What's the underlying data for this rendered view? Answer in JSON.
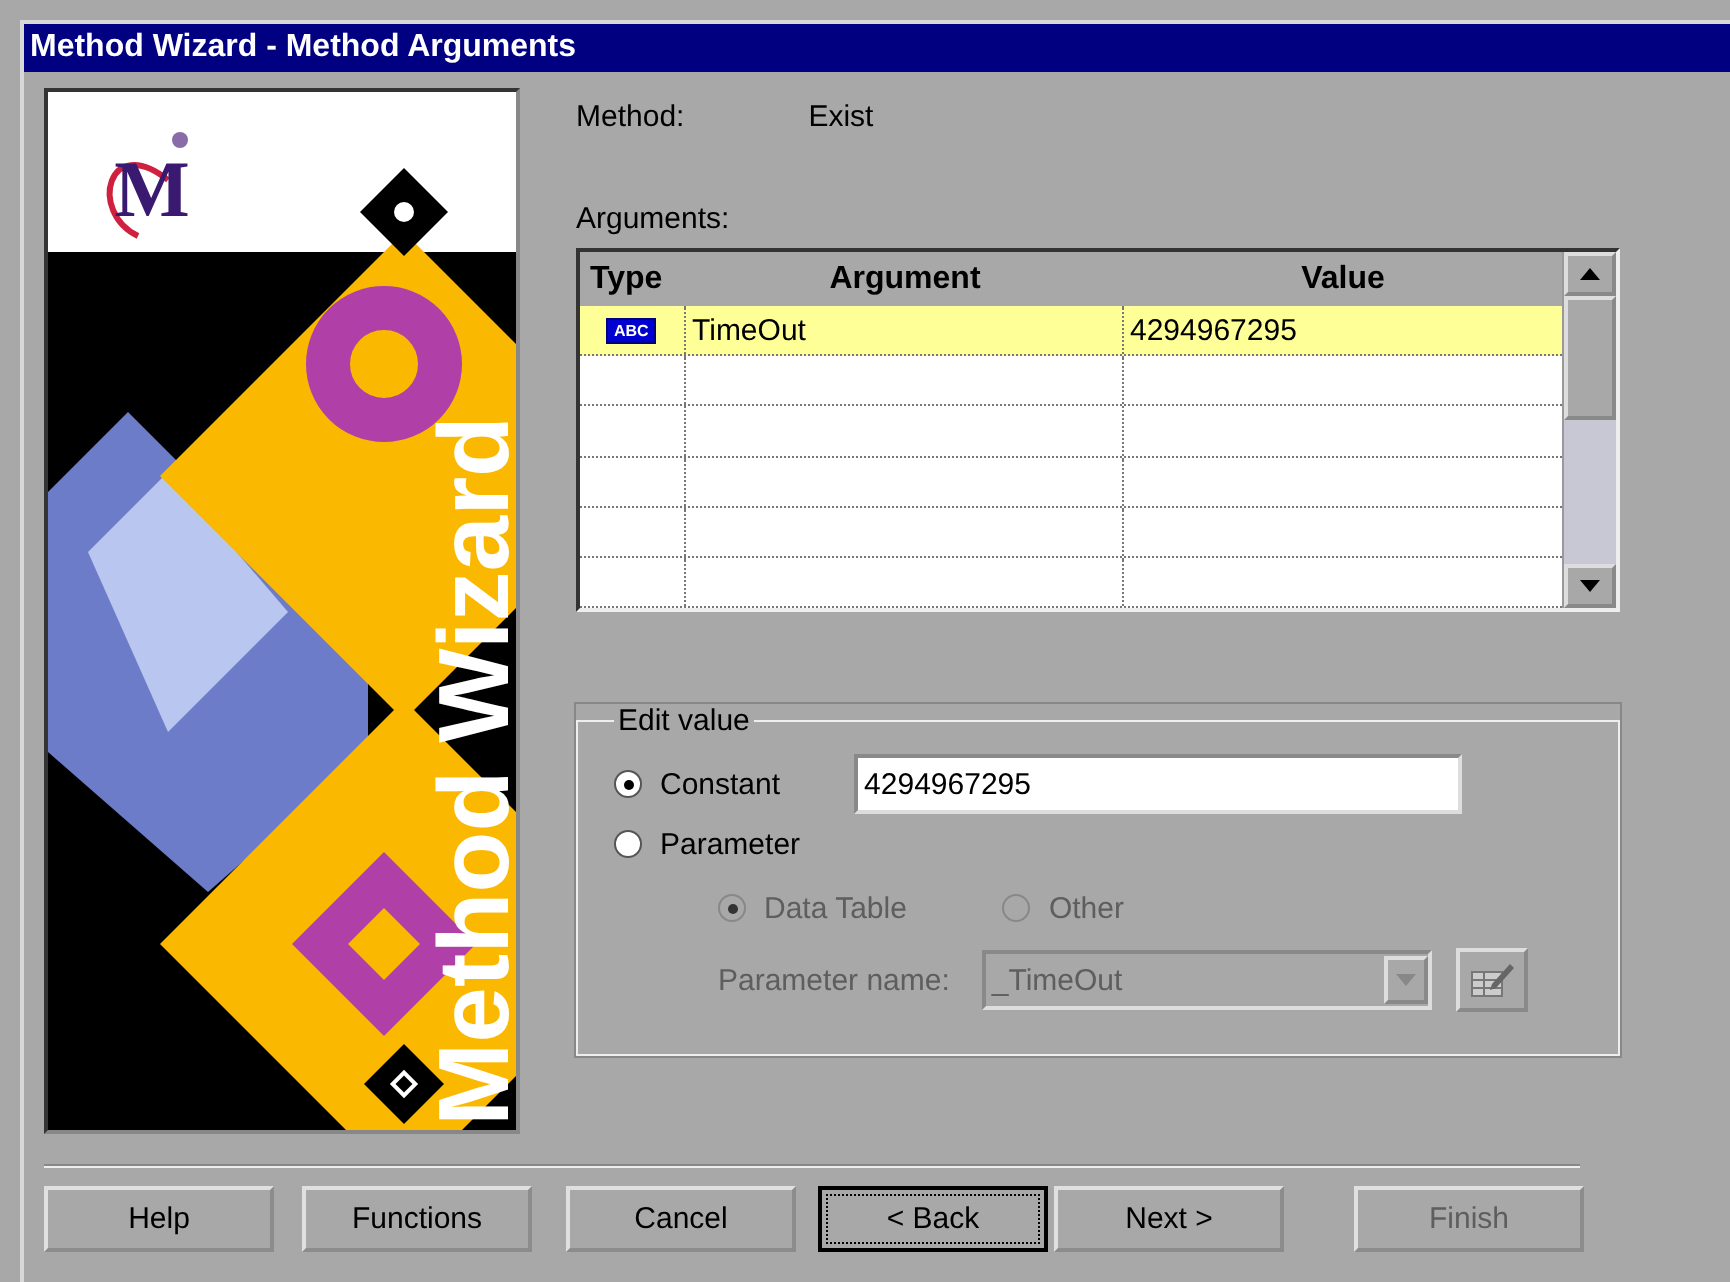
{
  "window": {
    "title": "Method Wizard - Method Arguments"
  },
  "banner": {
    "logo_text": "M",
    "title": "Method Wizard"
  },
  "method": {
    "label": "Method:",
    "value": "Exist"
  },
  "arguments": {
    "label": "Arguments:",
    "columns": [
      "Type",
      "Argument",
      "Value"
    ],
    "rows": [
      {
        "type_badge": "ABC",
        "argument": "TimeOut",
        "value": "4294967295",
        "selected": true
      }
    ]
  },
  "edit_value": {
    "legend": "Edit value",
    "options": [
      {
        "kind": "text",
        "label": "Constant",
        "selected": true,
        "disabled": false,
        "value": "4294967295"
      },
      {
        "kind": "plain",
        "label": "Parameter",
        "selected": false,
        "disabled": false
      }
    ],
    "sub_options": [
      {
        "label": "Data Table",
        "selected": true,
        "disabled": true
      },
      {
        "label": "Other",
        "selected": false,
        "disabled": true
      }
    ],
    "parameter_name": {
      "label": "Parameter name:",
      "value": "_TimeOut",
      "disabled": true
    }
  },
  "buttons": [
    {
      "label": "Help",
      "disabled": false,
      "focused": false
    },
    {
      "label": "Functions",
      "disabled": false,
      "focused": false
    },
    {
      "label": "Cancel",
      "disabled": false,
      "focused": false
    },
    {
      "label": "< Back",
      "disabled": false,
      "focused": true
    },
    {
      "label": "Next >",
      "disabled": false,
      "focused": false
    },
    {
      "label": "Finish",
      "disabled": true,
      "focused": false
    }
  ]
}
